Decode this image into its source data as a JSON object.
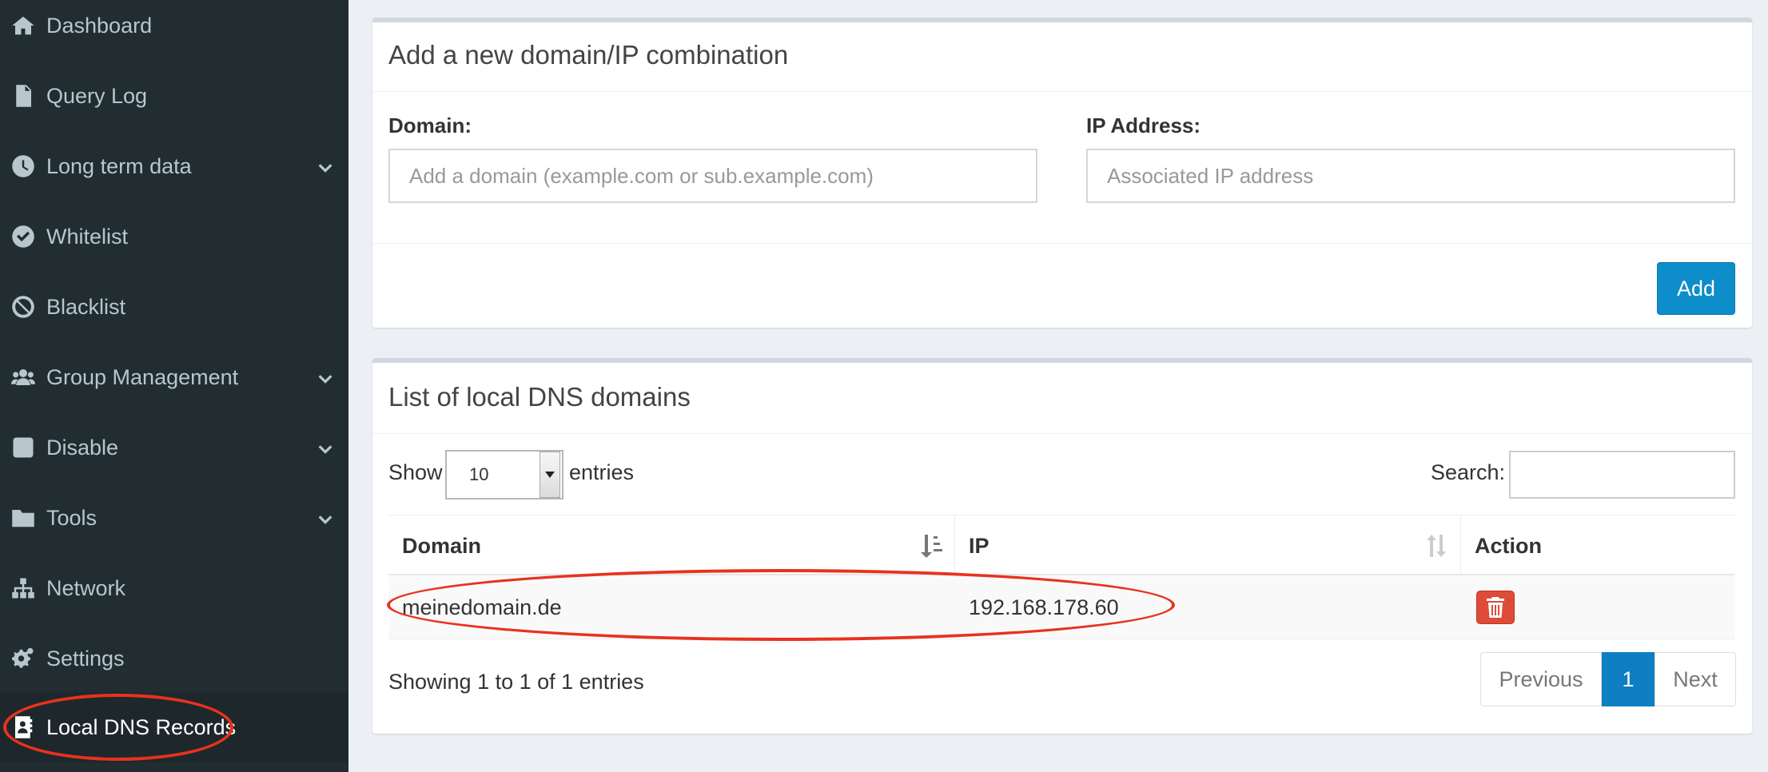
{
  "sidebar": {
    "items": [
      {
        "label": "Dashboard",
        "icon": "home-icon"
      },
      {
        "label": "Query Log",
        "icon": "file-icon"
      },
      {
        "label": "Long term data",
        "icon": "clock-icon",
        "expandable": true
      },
      {
        "label": "Whitelist",
        "icon": "check-circle-icon"
      },
      {
        "label": "Blacklist",
        "icon": "ban-icon"
      },
      {
        "label": "Group Management",
        "icon": "users-icon",
        "expandable": true
      },
      {
        "label": "Disable",
        "icon": "stop-icon",
        "expandable": true
      },
      {
        "label": "Tools",
        "icon": "folder-icon",
        "expandable": true
      },
      {
        "label": "Network",
        "icon": "network-icon"
      },
      {
        "label": "Settings",
        "icon": "gears-icon"
      },
      {
        "label": "Local DNS Records",
        "icon": "address-book-icon",
        "active": true
      }
    ]
  },
  "add_box": {
    "title": "Add a new domain/IP combination",
    "domain_label": "Domain:",
    "domain_placeholder": "Add a domain (example.com or sub.example.com)",
    "ip_label": "IP Address:",
    "ip_placeholder": "Associated IP address",
    "add_button": "Add"
  },
  "list_box": {
    "title": "List of local DNS domains",
    "show_label": "Show",
    "entries_value": "10",
    "entries_label": "entries",
    "search_label": "Search:",
    "search_value": "",
    "columns": [
      "Domain",
      "IP",
      "Action"
    ],
    "rows": [
      {
        "domain": "meinedomain.de",
        "ip": "192.168.178.60"
      }
    ],
    "info": "Showing 1 to 1 of 1 entries",
    "pagination": {
      "previous": "Previous",
      "current": "1",
      "next": "Next"
    }
  },
  "colors": {
    "sidebar_bg": "#222d32",
    "primary": "#0d8dc9",
    "danger": "#dd4b39",
    "highlight": "#e8321e"
  }
}
